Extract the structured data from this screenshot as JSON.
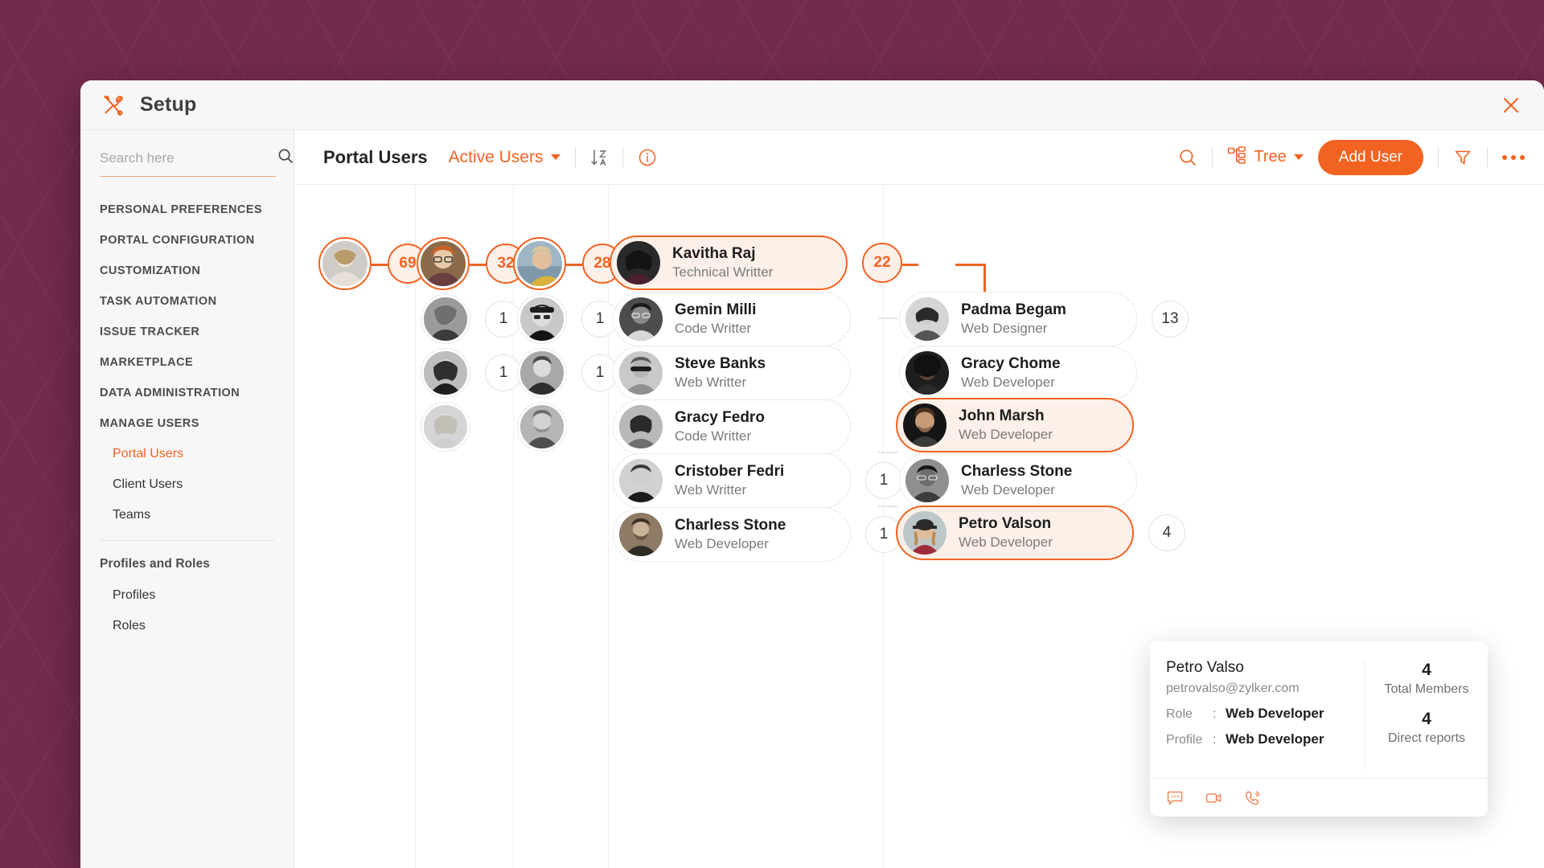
{
  "window": {
    "title": "Setup",
    "tools_icon": "tools-icon",
    "close_icon": "close-icon"
  },
  "sidebar": {
    "search": {
      "placeholder": "Search here",
      "value": "",
      "icon": "search-icon"
    },
    "sections": [
      {
        "label": "PERSONAL PREFERENCES"
      },
      {
        "label": "PORTAL CONFIGURATION"
      },
      {
        "label": "CUSTOMIZATION"
      },
      {
        "label": "TASK AUTOMATION"
      },
      {
        "label": "ISSUE TRACKER"
      },
      {
        "label": "MARKETPLACE"
      },
      {
        "label": "DATA ADMINISTRATION"
      },
      {
        "label": "MANAGE USERS"
      }
    ],
    "manage_users_items": [
      {
        "label": "Portal Users",
        "active": true
      },
      {
        "label": "Client Users",
        "active": false
      },
      {
        "label": "Teams",
        "active": false
      }
    ],
    "profiles_roles_head": "Profiles and Roles",
    "profiles_roles_items": [
      {
        "label": "Profiles"
      },
      {
        "label": "Roles"
      }
    ]
  },
  "toolbar": {
    "title": "Portal Users",
    "filter_label": "Active Users",
    "sort_icon": "sort-az-icon",
    "info_icon": "info-icon",
    "search_icon": "search-icon",
    "view_label": "Tree",
    "view_icon": "hierarchy-icon",
    "add_user_label": "Add User",
    "filter_icon": "funnel-icon",
    "more_icon": "more-options-icon"
  },
  "tree": {
    "columns": [
      {
        "name": "column-1",
        "nodes": [
          {
            "type": "avatar",
            "root": true,
            "badge": "69",
            "badge_hot": true,
            "avatar": "woman-blonde-office"
          }
        ]
      },
      {
        "name": "column-2",
        "nodes": [
          {
            "type": "avatar",
            "root": true,
            "badge": "32",
            "badge_hot": true,
            "avatar": "man-glasses-ginger"
          },
          {
            "type": "avatar",
            "root": false,
            "badge": "1",
            "badge_hot": false,
            "avatar": "man-beard-grey"
          },
          {
            "type": "avatar",
            "root": false,
            "badge": "1",
            "badge_hot": false,
            "avatar": "woman-dark-hair"
          },
          {
            "type": "avatar",
            "root": false,
            "badge": "",
            "badge_hot": false,
            "avatar": "woman-light-hair"
          }
        ]
      },
      {
        "name": "column-3",
        "nodes": [
          {
            "type": "avatar",
            "root": true,
            "badge": "28",
            "badge_hot": true,
            "avatar": "man-profile-outdoor"
          },
          {
            "type": "avatar",
            "root": false,
            "badge": "1",
            "badge_hot": false,
            "avatar": "man-cap-glasses"
          },
          {
            "type": "avatar",
            "root": false,
            "badge": "1",
            "badge_hot": false,
            "avatar": "man-smiling-young"
          },
          {
            "type": "avatar",
            "root": false,
            "badge": "",
            "badge_hot": false,
            "avatar": "man-beard-outdoor"
          }
        ]
      },
      {
        "name": "column-4",
        "cards": [
          {
            "name": "Kavitha Raj",
            "role": "Technical Writter",
            "badge": "22",
            "badge_hot": true,
            "highlighted": true,
            "avatar": "woman-curly-dark"
          },
          {
            "name": "Gemin Milli",
            "role": "Code Writter",
            "badge": "",
            "badge_hot": false,
            "highlighted": false,
            "avatar": "man-glasses-smile"
          },
          {
            "name": "Steve Banks",
            "role": "Web Writter",
            "badge": "",
            "badge_hot": false,
            "highlighted": false,
            "avatar": "man-sunglasses"
          },
          {
            "name": "Gracy Fedro",
            "role": "Code Writter",
            "badge": "",
            "badge_hot": false,
            "highlighted": false,
            "avatar": "woman-smiling-street"
          },
          {
            "name": "Cristober Fedri",
            "role": "Web Writter",
            "badge": "1",
            "badge_hot": false,
            "highlighted": false,
            "avatar": "man-short-hair"
          },
          {
            "name": "Charless Stone",
            "role": "Web Developer",
            "badge": "1",
            "badge_hot": false,
            "highlighted": false,
            "avatar": "man-beard-wall"
          }
        ]
      },
      {
        "name": "column-5",
        "cards": [
          {
            "name": "Padma Begam",
            "role": "Web Designer",
            "badge": "13",
            "badge_hot": false,
            "highlighted": false,
            "avatar": "woman-short-hair"
          },
          {
            "name": "Gracy Chome",
            "role": "Web Developer",
            "badge": "",
            "badge_hot": false,
            "highlighted": false,
            "avatar": "woman-afro"
          },
          {
            "name": "John Marsh",
            "role": "Web Developer",
            "badge": "",
            "badge_hot": false,
            "highlighted": true,
            "avatar": "man-dark-portrait"
          },
          {
            "name": "Charless Stone",
            "role": "Web Developer",
            "badge": "",
            "badge_hot": false,
            "highlighted": false,
            "avatar": "man-glasses-dark"
          },
          {
            "name": "Petro Valson",
            "role": "Web Developer",
            "badge": "4",
            "badge_hot": false,
            "highlighted": true,
            "avatar": "woman-hat-red"
          }
        ]
      }
    ]
  },
  "popup": {
    "name": "Petro Valso",
    "email": "petrovalso@zylker.com",
    "role_key": "Role",
    "role_value": "Web Developer",
    "profile_key": "Profile",
    "profile_value": "Web Developer",
    "total_members_count": "4",
    "total_members_label": "Total Members",
    "direct_reports_count": "4",
    "direct_reports_label": "Direct reports",
    "actions": [
      {
        "icon": "chat-icon"
      },
      {
        "icon": "video-call-icon"
      },
      {
        "icon": "phone-call-icon"
      }
    ]
  },
  "colors": {
    "accent": "#f26322",
    "backdrop": "#732b4c",
    "highlight_bg": "#fdf0e9"
  }
}
